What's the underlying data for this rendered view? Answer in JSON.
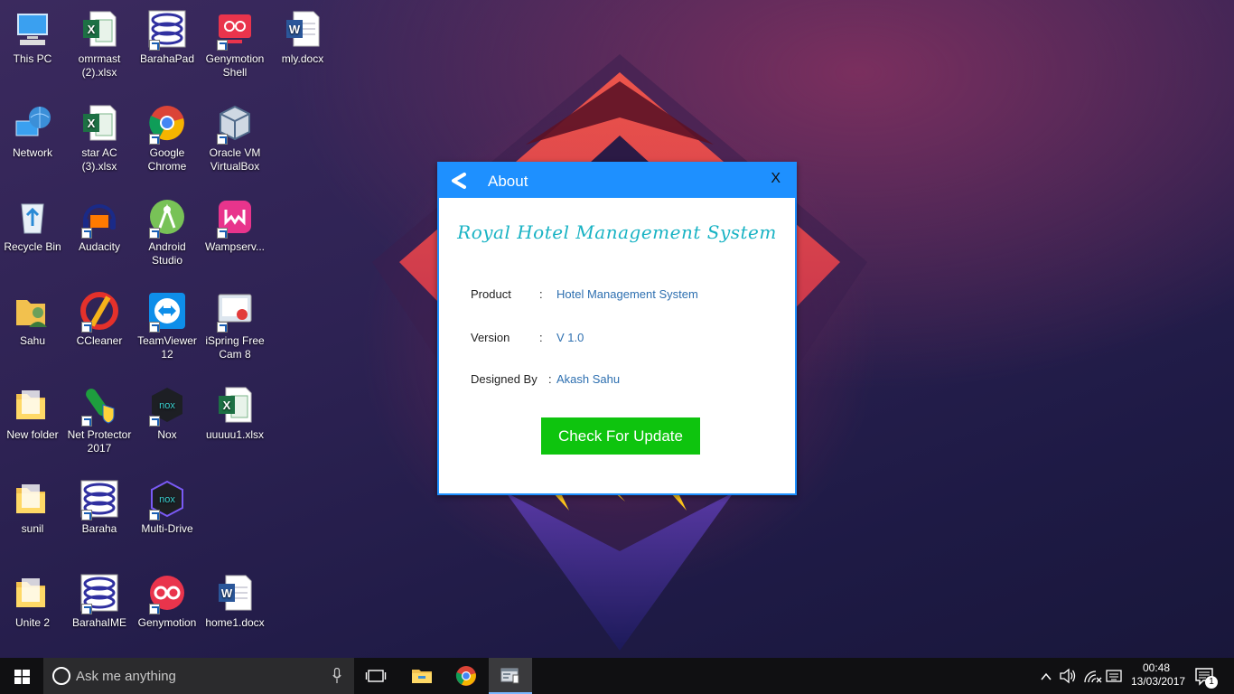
{
  "desktop": {
    "icons": [
      {
        "label": "This PC",
        "icon": "computer-icon"
      },
      {
        "label": "omrmast (2).xlsx",
        "icon": "excel-icon"
      },
      {
        "label": "BarahaPad",
        "icon": "baraha-icon"
      },
      {
        "label": "Genymotion Shell",
        "icon": "genymotion-shell-icon"
      },
      {
        "label": "mly.docx",
        "icon": "word-icon"
      },
      {
        "label": "Network",
        "icon": "network-icon"
      },
      {
        "label": "star AC (3).xlsx",
        "icon": "excel-icon"
      },
      {
        "label": "Google Chrome",
        "icon": "chrome-icon"
      },
      {
        "label": "Oracle VM VirtualBox",
        "icon": "virtualbox-icon"
      },
      {
        "label": "Recycle Bin",
        "icon": "recycle-bin-icon"
      },
      {
        "label": "Audacity",
        "icon": "audacity-icon"
      },
      {
        "label": "Android Studio",
        "icon": "android-studio-icon"
      },
      {
        "label": "Wampserv...",
        "icon": "wamp-icon"
      },
      {
        "label": "Sahu",
        "icon": "user-folder-icon"
      },
      {
        "label": "CCleaner",
        "icon": "ccleaner-icon"
      },
      {
        "label": "TeamViewer 12",
        "icon": "teamviewer-icon"
      },
      {
        "label": "iSpring Free Cam 8",
        "icon": "ispring-icon"
      },
      {
        "label": "New folder",
        "icon": "folder-icon"
      },
      {
        "label": "Net Protector 2017",
        "icon": "net-protector-icon"
      },
      {
        "label": "Nox",
        "icon": "nox-icon"
      },
      {
        "label": "uuuuu1.xlsx",
        "icon": "excel-icon"
      },
      {
        "label": "sunil",
        "icon": "folder-icon"
      },
      {
        "label": "Baraha",
        "icon": "baraha-icon"
      },
      {
        "label": "Multi-Drive",
        "icon": "nox-multi-icon"
      },
      {
        "label": "Unite 2",
        "icon": "folder-icon"
      },
      {
        "label": "BarahaIME",
        "icon": "baraha-icon"
      },
      {
        "label": "Genymotion",
        "icon": "genymotion-icon"
      },
      {
        "label": "home1.docx",
        "icon": "word-icon"
      }
    ]
  },
  "dialog": {
    "title": "About",
    "close_label": "X",
    "app_title": "Royal Hotel Management System",
    "rows": [
      {
        "key": "Product",
        "colon": ":",
        "value": "Hotel Management System"
      },
      {
        "key": "Version",
        "colon": ":",
        "value": "V 1.0"
      },
      {
        "key": "Designed By",
        "colon": ":",
        "value": "Akash Sahu"
      }
    ],
    "update_button": "Check For Update",
    "colors": {
      "header": "#1e90ff",
      "title": "#19b3c4",
      "button": "#0ec40e"
    }
  },
  "taskbar": {
    "search_placeholder": "Ask me anything",
    "clock_time": "00:48",
    "clock_date": "13/03/2017",
    "notification_count": "1"
  }
}
